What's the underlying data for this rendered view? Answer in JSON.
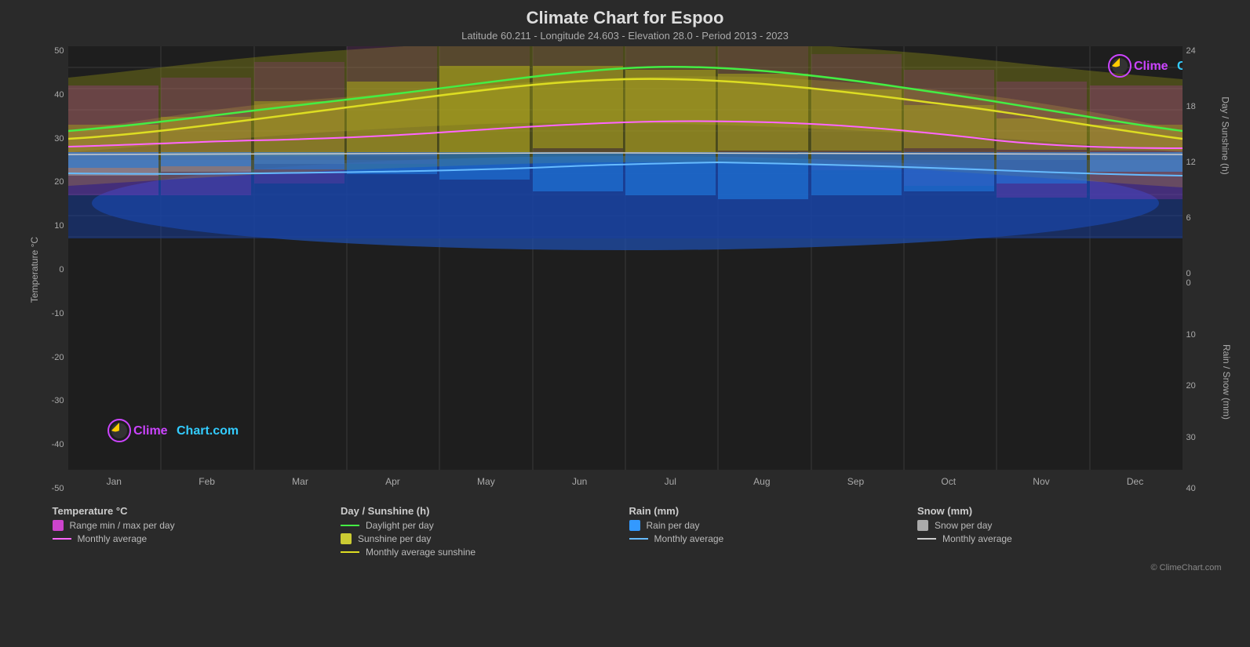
{
  "page": {
    "title": "Climate Chart for Espoo",
    "subtitle": "Latitude 60.211 - Longitude 24.603 - Elevation 28.0 - Period 2013 - 2023",
    "logo_text": "ClimeChart.com",
    "copyright": "© ClimeChart.com"
  },
  "axes": {
    "left_title": "Temperature °C",
    "right_top_title": "Day / Sunshine (h)",
    "right_bottom_title": "Rain / Snow (mm)",
    "left_labels": [
      "50",
      "40",
      "30",
      "20",
      "10",
      "0",
      "-10",
      "-20",
      "-30",
      "-40",
      "-50"
    ],
    "right_top_labels": [
      "24",
      "18",
      "12",
      "6",
      "0"
    ],
    "right_bottom_labels": [
      "0",
      "10",
      "20",
      "30",
      "40"
    ],
    "x_labels": [
      "Jan",
      "Feb",
      "Mar",
      "Apr",
      "May",
      "Jun",
      "Jul",
      "Aug",
      "Sep",
      "Oct",
      "Nov",
      "Dec"
    ]
  },
  "legend": {
    "temp_title": "Temperature °C",
    "day_title": "Day / Sunshine (h)",
    "rain_title": "Rain (mm)",
    "snow_title": "Snow (mm)",
    "items": {
      "range_min_max": "Range min / max per day",
      "monthly_avg_temp": "Monthly average",
      "daylight": "Daylight per day",
      "sunshine_per_day": "Sunshine per day",
      "monthly_avg_sunshine": "Monthly average sunshine",
      "rain_per_day": "Rain per day",
      "monthly_avg_rain": "Monthly average",
      "snow_per_day": "Snow per day",
      "monthly_avg_snow": "Monthly average"
    }
  },
  "colors": {
    "background": "#2a2a2a",
    "plot_bg": "#1e1e1e",
    "grid": "#3a3a3a",
    "temp_range": "#cc44cc",
    "temp_avg": "#ff66ff",
    "daylight": "#44dd44",
    "sunshine": "#cccc33",
    "rain": "#3399ff",
    "rain_avg": "#66bbff",
    "snow": "#aaaaaa",
    "snow_avg": "#cccccc",
    "text": "#cccccc",
    "subtitle": "#aaaaaa"
  }
}
